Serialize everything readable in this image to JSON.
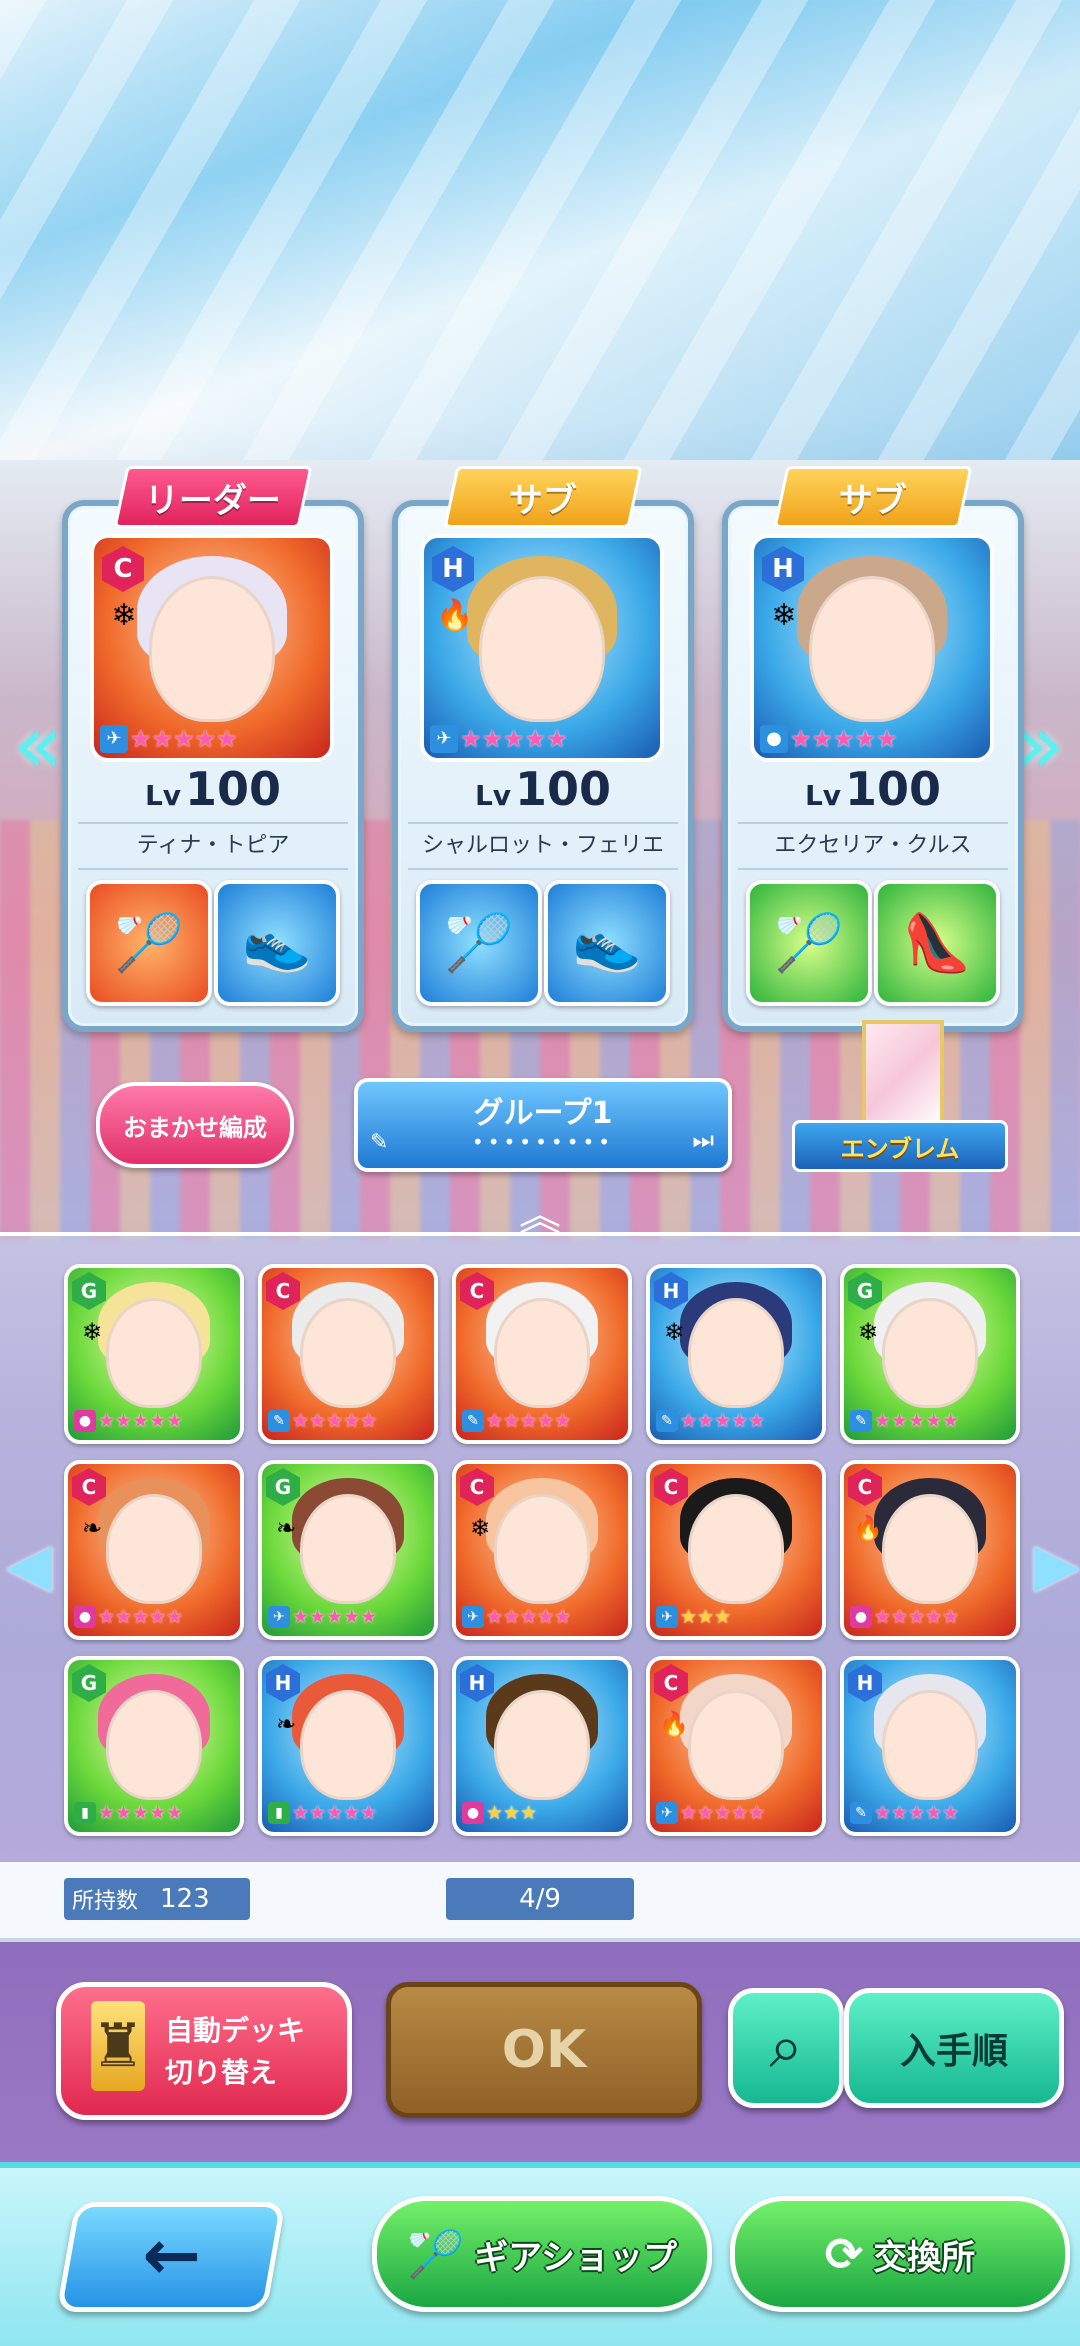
{
  "leaders": [
    {
      "role": "リーダー",
      "level": "100",
      "name": "ティナ・トピア",
      "rank": "C",
      "element": "❄",
      "type": "✈",
      "stars": "★★★★★",
      "portrait": "red",
      "hair": "#e8e4f4",
      "gear1": "🏸",
      "gear2": "👟",
      "gearColor1": "red",
      "gearColor2": "blue"
    },
    {
      "role": "サブ",
      "level": "100",
      "name": "シャルロット・フェリエ",
      "rank": "H",
      "element": "🔥",
      "type": "✈",
      "stars": "★★★★★",
      "portrait": "blue",
      "hair": "#e0b560",
      "gear1": "🏸",
      "gear2": "👟",
      "gearColor1": "blue",
      "gearColor2": "blue"
    },
    {
      "role": "サブ",
      "level": "100",
      "name": "エクセリア・クルス",
      "rank": "H",
      "element": "❄",
      "type": "●",
      "stars": "★★★★★",
      "portrait": "blue",
      "hair": "#c9a88c",
      "gear1": "🏸",
      "gear2": "👠",
      "gearColor1": "green",
      "gearColor2": "green"
    }
  ],
  "level_prefix": "Lv",
  "auto_button": "おまかせ編成",
  "group": {
    "title": "グループ1",
    "dots": "•••••••••",
    "current_page": 1,
    "total_pages": 9
  },
  "emblem_label": "エンブレム",
  "roster": [
    {
      "rank": "G",
      "portrait": "green",
      "hair": "#f6e39a",
      "element": "❄",
      "type": "●",
      "stars": "★★★★★"
    },
    {
      "rank": "C",
      "portrait": "red",
      "hair": "#ececec",
      "element": "",
      "type": "✎",
      "stars": "★★★★★"
    },
    {
      "rank": "C",
      "portrait": "red",
      "hair": "#f2f2f2",
      "element": "",
      "type": "✎",
      "stars": "★★★★★"
    },
    {
      "rank": "H",
      "portrait": "blue",
      "hair": "#2a3a7a",
      "element": "❄",
      "type": "✎",
      "stars": "★★★★★"
    },
    {
      "rank": "G",
      "portrait": "green",
      "hair": "#f0f0f0",
      "element": "❄",
      "type": "✎",
      "stars": "★★★★★"
    },
    {
      "rank": "C",
      "portrait": "red",
      "hair": "#e8915a",
      "element": "❧",
      "type": "●",
      "stars": "★★★★★"
    },
    {
      "rank": "G",
      "portrait": "green",
      "hair": "#8a4a34",
      "element": "❧",
      "type": "✈",
      "stars": "★★★★★"
    },
    {
      "rank": "C",
      "portrait": "red",
      "hair": "#f7c6a0",
      "element": "❄",
      "type": "✈",
      "stars": "★★★★★"
    },
    {
      "rank": "C",
      "portrait": "red",
      "hair": "#1a1a1a",
      "element": "",
      "type": "✈",
      "stars": "★★★"
    },
    {
      "rank": "C",
      "portrait": "red",
      "hair": "#2a2a3a",
      "element": "🔥",
      "type": "●",
      "stars": "★★★★★"
    },
    {
      "rank": "G",
      "portrait": "green",
      "hair": "#f06a9a",
      "element": "",
      "type": "▮",
      "stars": "★★★★★"
    },
    {
      "rank": "H",
      "portrait": "blue",
      "hair": "#e85a3a",
      "element": "❧",
      "type": "▮",
      "stars": "★★★★★"
    },
    {
      "rank": "H",
      "portrait": "blue",
      "hair": "#5a3a1a",
      "element": "",
      "type": "●",
      "stars": "★★★"
    },
    {
      "rank": "C",
      "portrait": "red",
      "hair": "#f2d6c8",
      "element": "🔥",
      "type": "✈",
      "stars": "★★★★★"
    },
    {
      "rank": "H",
      "portrait": "blue",
      "hair": "#e6e6ee",
      "element": "",
      "type": "✎",
      "stars": "★★★★★"
    }
  ],
  "owned_label": "所持数",
  "owned_count": "123",
  "page_label": "4/9",
  "auto_deck": {
    "line1": "自動デッキ",
    "line2": "切り替え"
  },
  "ok_label": "OK",
  "sort_label": "入手順",
  "shop_label": "ギアショップ",
  "exchange_label": "交換所",
  "colors": {
    "leader_tag": "#e0235d",
    "sub_tag": "#f0a21b",
    "ok_button": "#8f6128",
    "teal_button": "#15b890",
    "green_button": "#1aa742"
  }
}
